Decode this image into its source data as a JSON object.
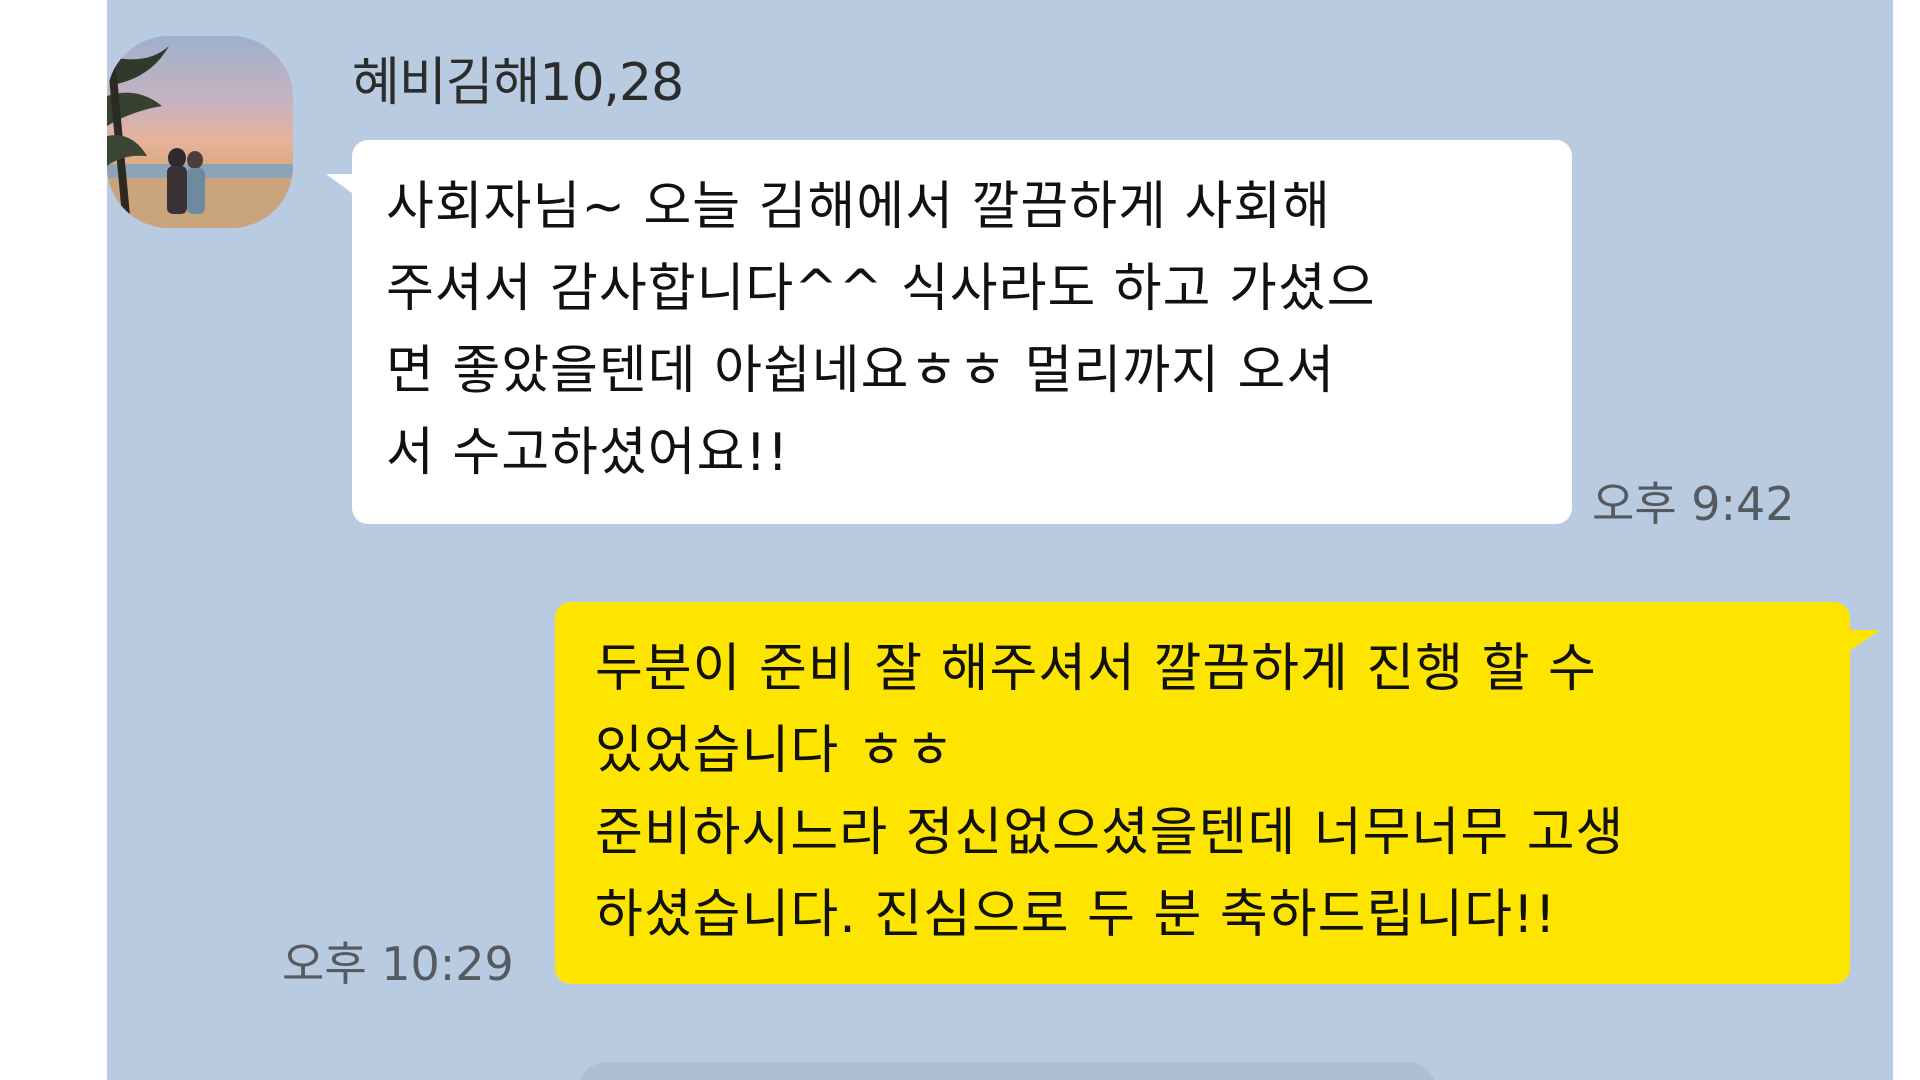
{
  "chat": {
    "background_color": "#b8cbe0",
    "incoming": {
      "sender": "혜비김해10,28",
      "avatar": "profile-photo-beach-couple",
      "lines": [
        "사회자님~ 오늘 김해에서 깔끔하게 사회해",
        "주셔서 감사합니다^^ 식사라도 하고 가셨으",
        "면 좋았을텐데 아쉽네요ㅎㅎ 멀리까지 오셔",
        "서 수고하셨어요!!"
      ],
      "time": "오후 9:42",
      "bubble_color": "#ffffff"
    },
    "outgoing": {
      "lines": [
        "두분이 준비 잘 해주셔서 깔끔하게 진행 할 수",
        "있었습니다 ㅎㅎ",
        "준비하시느라 정신없으셨을텐데 너무너무 고생",
        "하셨습니다. 진심으로 두 분 축하드립니다!!"
      ],
      "time": "오후 10:29",
      "bubble_color": "#fee500"
    }
  }
}
